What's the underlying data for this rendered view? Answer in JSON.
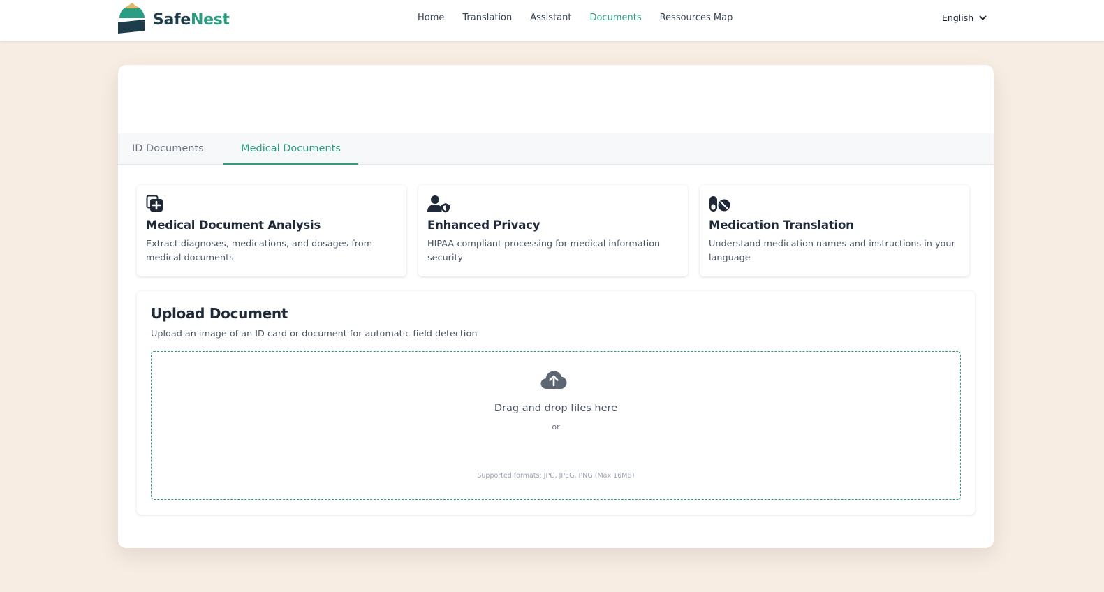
{
  "brand": {
    "name_part1": "Safe",
    "name_part2": "Nest",
    "logo_icon": "safenest-logo"
  },
  "nav": {
    "links": [
      {
        "label": "Home",
        "active": false
      },
      {
        "label": "Translation",
        "active": false
      },
      {
        "label": "Assistant",
        "active": false
      },
      {
        "label": "Documents",
        "active": true
      },
      {
        "label": "Ressources Map",
        "active": false
      }
    ],
    "language": {
      "selected": "English",
      "icon": "chevron-down-icon"
    }
  },
  "tabs": [
    {
      "label": "ID Documents",
      "active": false
    },
    {
      "label": "Medical Documents",
      "active": true
    }
  ],
  "features": [
    {
      "icon": "medical-file-icon",
      "title": "Medical Document Analysis",
      "description": "Extract diagnoses, medications, and dosages from medical documents"
    },
    {
      "icon": "user-shield-icon",
      "title": "Enhanced Privacy",
      "description": "HIPAA-compliant processing for medical information security"
    },
    {
      "icon": "pills-icon",
      "title": "Medication Translation",
      "description": "Understand medication names and instructions in your language"
    }
  ],
  "upload": {
    "title": "Upload Document",
    "subtitle": "Upload an image of an ID card or document for automatic field detection",
    "dropzone": {
      "icon": "cloud-upload-icon",
      "title": "Drag and drop files here",
      "or": "or",
      "formats": "Supported formats: JPG, JPEG, PNG (Max 16MB)"
    }
  },
  "colors": {
    "accent": "#2a9d83",
    "brand_dark": "#1e3d4a",
    "logo_gold": "#e0b86a",
    "page_background": "#f8ede3",
    "card_background": "#ffffff",
    "text_primary": "#1f2937",
    "text_secondary": "#4b5563"
  }
}
